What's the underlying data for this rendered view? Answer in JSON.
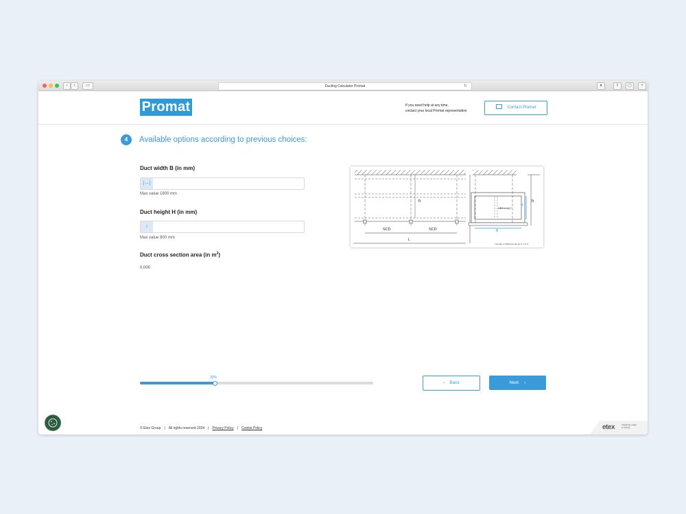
{
  "browser": {
    "title": "Ducting Calculator Promat"
  },
  "header": {
    "logo": "Promat",
    "help_line1": "If you need help at any time,",
    "help_line2": "contact your local Promat representative",
    "contact_button": "Contact Promat"
  },
  "step": {
    "number": "4",
    "title": "Available options according to previous choices:"
  },
  "fields": {
    "width": {
      "label": "Duct width B (in mm)",
      "value": "",
      "hint": "Max value 1800 mm",
      "icon": "width-arrows-icon"
    },
    "height": {
      "label": "Duct height H (in mm)",
      "value": "",
      "hint": "Max value 800 mm",
      "icon": "height-arrows-icon"
    },
    "area": {
      "label": "Duct cross section area (in m",
      "label_sup": "2",
      "label_end": ")",
      "value": "0.000"
    }
  },
  "diagram": {
    "labels": {
      "h_left": "h",
      "scd1": "SCD",
      "scd2": "SCD",
      "l": "L",
      "h_right": "h",
      "H": "H",
      "B": "B",
      "stiffener": "stiffeners(n)*",
      "footnote": "* number of stiffeners can be 0, 1 or 2"
    }
  },
  "progress": {
    "label": "32%",
    "value": 0.32
  },
  "navigation": {
    "back": "Back",
    "next": "Next"
  },
  "footer": {
    "copyright": "© Etex Group",
    "rights": "All rights reserved 2024",
    "privacy": "Privacy Policy",
    "cookie": "Cookie Policy"
  },
  "brand": {
    "etex": "etex",
    "tagline1": "Inspiring ways",
    "tagline2": "of living"
  },
  "colors": {
    "accent": "#3b9ad9",
    "logo_bg": "#2e9bd6",
    "background": "#e9f0f7"
  }
}
